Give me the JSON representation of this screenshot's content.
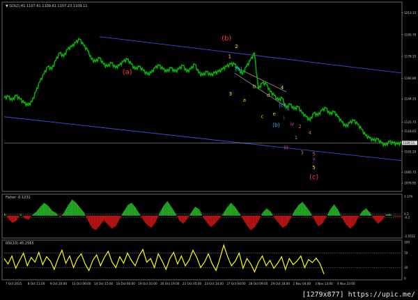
{
  "window": {
    "main_title": "▼ GOLD,H1  1107.61  1109.61  1107.23  1109.11",
    "watermark": "[1279x877] https://upic.me/"
  },
  "colors": {
    "price": "#00c000",
    "channel": "#3a4bd8",
    "hline": "#9a9a9a",
    "fisher_pos": "#23a623",
    "fisher_neg": "#b31313",
    "rsi": "#ffff00",
    "grid_dot": "#7a7a7a",
    "text": "#cfcfcf",
    "wave_red": "#ff3a2a",
    "wave_yellow": "#ffe640",
    "wave_cyan": "#29b6ff",
    "wave_magenta": "#d03dd0",
    "wave_small_yellow": "#e6d800",
    "wave_small_brown": "#c07840"
  },
  "chart_data": [
    {
      "type": "line",
      "title": "GOLD,H1",
      "ohlc": {
        "open": 1107.61,
        "high": 1109.61,
        "low": 1107.23,
        "close": 1109.11
      },
      "y_ticks": [
        1213.15,
        1195.7,
        1178.25,
        1160.8,
        1144.25,
        1125.75,
        1118.65,
        1102.2,
        1085.75,
        1076.95
      ],
      "current_price": "1109.11",
      "ylim": [
        1072,
        1220
      ],
      "x_ticks": [
        "7 Oct 2015",
        "8 Oct 11:00",
        "9 Oct 20:00",
        "13 Oct 06:00",
        "14 Oct 15:00",
        "16 Oct 00:00",
        "19 Oct 10:00",
        "20 Oct 19:00",
        "22 Oct 05:00",
        "23 Oct 14:00",
        "27 Oct 00:00",
        "28 Oct 09:00",
        "29 Oct 18:00",
        "2 Nov 04:00",
        "3 Nov 13:00",
        "4 Nov 23:00"
      ],
      "x_range": [
        0,
        100
      ],
      "series": [
        {
          "x": [
            0,
            1,
            2,
            3,
            4,
            5,
            6,
            7,
            8,
            9,
            10,
            11,
            12,
            13,
            14,
            15,
            16,
            17,
            18,
            19,
            20,
            21,
            22,
            23,
            24,
            25,
            26,
            27,
            28,
            29,
            30,
            31,
            32,
            33,
            34,
            35,
            36,
            37,
            38,
            39,
            40,
            41,
            42,
            43,
            44,
            45,
            46,
            47,
            48,
            49,
            50,
            51,
            52,
            53,
            54,
            55,
            56,
            57,
            58,
            59,
            60,
            61,
            62,
            63,
            64,
            65,
            66,
            67,
            68,
            69,
            70,
            71,
            72,
            73,
            74,
            75,
            76,
            77,
            78,
            79,
            80,
            81,
            82,
            83,
            84,
            85,
            86,
            87,
            88,
            89,
            90,
            91,
            92,
            93,
            94,
            95,
            96,
            97,
            98,
            99,
            100
          ],
          "values": [
            1145,
            1146,
            1143,
            1147,
            1144,
            1141,
            1139,
            1142,
            1150,
            1158,
            1164,
            1170,
            1168,
            1175,
            1181,
            1178,
            1184,
            1186,
            1189,
            1192,
            1187,
            1183,
            1176,
            1174,
            1177,
            1172,
            1170,
            1173,
            1169,
            1171,
            1174,
            1176,
            1172,
            1168,
            1170,
            1167,
            1164,
            1165,
            1169,
            1171,
            1168,
            1166,
            1169,
            1166,
            1168,
            1171,
            1166,
            1168,
            1172,
            1165,
            1163,
            1166,
            1163,
            1165,
            1166,
            1168,
            1170,
            1172,
            1172,
            1168,
            1164,
            1170,
            1175,
            1181,
            1152,
            1157,
            1156,
            1150,
            1147,
            1143,
            1145,
            1137,
            1140,
            1136,
            1138,
            1133,
            1130,
            1127,
            1133,
            1131,
            1135,
            1137,
            1132,
            1134,
            1130,
            1126,
            1122,
            1125,
            1127,
            1124,
            1120,
            1115,
            1113,
            1111,
            1112,
            1109,
            1107,
            1110,
            1109,
            1108,
            1109
          ]
        }
      ],
      "channel_upper": {
        "x": [
          24,
          100
        ],
        "values": [
          1194,
          1165
        ]
      },
      "channel_lower": {
        "x": [
          0,
          100
        ],
        "values": [
          1130,
          1095
        ]
      },
      "wedge_upper": {
        "x": [
          58,
          71
        ],
        "values": [
          1170,
          1150
        ]
      },
      "wedge_lower": {
        "x": [
          58,
          71
        ],
        "values": [
          1165,
          1138
        ]
      },
      "horizontal_line": 1109.11,
      "wave_labels": [
        {
          "text": "(a)",
          "x": 31,
          "y": 1164,
          "color": "wave_red"
        },
        {
          "text": "(b)",
          "x": 56,
          "y": 1191,
          "color": "wave_red"
        },
        {
          "text": "2",
          "x": 58.5,
          "y": 1185,
          "color": "wave_yellow"
        },
        {
          "text": "1",
          "x": 56.8,
          "y": 1177,
          "color": "wave_yellow"
        },
        {
          "text": "3",
          "x": 57,
          "y": 1147,
          "color": "wave_yellow"
        },
        {
          "text": "(a)",
          "x": 59,
          "y": 1167,
          "color": "wave_cyan"
        },
        {
          "text": "a",
          "x": 60.5,
          "y": 1142,
          "color": "wave_small_yellow"
        },
        {
          "text": "b",
          "x": 63,
          "y": 1153,
          "color": "wave_small_yellow"
        },
        {
          "text": "c",
          "x": 65,
          "y": 1129,
          "color": "wave_small_yellow"
        },
        {
          "text": "d",
          "x": 66.5,
          "y": 1146,
          "color": "wave_small_yellow"
        },
        {
          "text": "e",
          "x": 68,
          "y": 1131,
          "color": "wave_small_yellow"
        },
        {
          "text": "4",
          "x": 70,
          "y": 1152,
          "color": "wave_yellow"
        },
        {
          "text": "(c)",
          "x": 70,
          "y": 1138,
          "color": "wave_cyan"
        },
        {
          "text": "(b)",
          "x": 68.5,
          "y": 1122,
          "color": "wave_cyan"
        },
        {
          "text": "i",
          "x": 70.5,
          "y": 1128,
          "color": "wave_magenta"
        },
        {
          "text": "ii",
          "x": 71.5,
          "y": 1135,
          "color": "wave_magenta"
        },
        {
          "text": "iv",
          "x": 72.5,
          "y": 1123,
          "color": "wave_magenta"
        },
        {
          "text": "iii",
          "x": 71,
          "y": 1104,
          "color": "wave_magenta"
        },
        {
          "text": "1",
          "x": 73.5,
          "y": 1112,
          "color": "wave_small_brown"
        },
        {
          "text": "2",
          "x": 74.5,
          "y": 1121,
          "color": "wave_small_brown"
        },
        {
          "text": "3",
          "x": 75,
          "y": 1100,
          "color": "wave_small_brown"
        },
        {
          "text": "4",
          "x": 77,
          "y": 1116,
          "color": "wave_small_brown"
        },
        {
          "text": "5",
          "x": 78,
          "y": 1099,
          "color": "wave_small_brown"
        },
        {
          "text": "v",
          "x": 78,
          "y": 1095,
          "color": "wave_magenta"
        },
        {
          "text": "5",
          "x": 78,
          "y": 1088,
          "color": "wave_yellow"
        },
        {
          "text": "(c)",
          "x": 78,
          "y": 1080,
          "color": "wave_red"
        }
      ]
    },
    {
      "type": "bar",
      "title": "Fisher -0.1231",
      "y_ticks": [
        "2.379",
        "0.2",
        "-0.2",
        "-2.5551"
      ],
      "ylim": [
        -2.6,
        2.4
      ],
      "levels": [
        0.2,
        -0.2
      ],
      "x": [
        0,
        1,
        2,
        3,
        4,
        5,
        6,
        7,
        8,
        9,
        10,
        11,
        12,
        13,
        14,
        15,
        16,
        17,
        18,
        19,
        20,
        21,
        22,
        23,
        24,
        25,
        26,
        27,
        28,
        29,
        30,
        31,
        32,
        33,
        34,
        35,
        36,
        37,
        38,
        39,
        40,
        41,
        42,
        43,
        44,
        45,
        46,
        47,
        48,
        49,
        50,
        51,
        52,
        53,
        54,
        55,
        56,
        57,
        58,
        59,
        60,
        61,
        62,
        63,
        64,
        65,
        66,
        67,
        68,
        69,
        70,
        71,
        72,
        73,
        74,
        75,
        76,
        77,
        78,
        79,
        80,
        81,
        82,
        83,
        84,
        85,
        86,
        87,
        88,
        89,
        90,
        91,
        92,
        93,
        94,
        95,
        96,
        97,
        98,
        99,
        100
      ],
      "values": [
        0.3,
        -0.4,
        -0.9,
        -0.6,
        0.2,
        -0.3,
        -0.5,
        0.1,
        0.5,
        1.1,
        1.6,
        1.2,
        0.6,
        0.3,
        -0.2,
        0.4,
        1.3,
        2.0,
        1.6,
        1.0,
        0.4,
        -0.6,
        -1.5,
        -1.8,
        -1.2,
        -0.6,
        -1.1,
        -1.6,
        -1.3,
        -0.4,
        0.5,
        1.3,
        1.6,
        1.0,
        0.2,
        -0.6,
        -1.2,
        -1.5,
        -0.8,
        0.3,
        1.2,
        1.8,
        1.1,
        0.3,
        -0.6,
        -1.0,
        -0.4,
        0.4,
        1.1,
        0.8,
        -0.2,
        -0.9,
        -1.4,
        -1.0,
        -0.4,
        0.2,
        1.0,
        1.6,
        1.1,
        0.4,
        -0.4,
        -1.2,
        -1.8,
        -1.4,
        -0.6,
        0.4,
        0.9,
        0.5,
        -0.3,
        -0.9,
        -1.5,
        -1.2,
        -0.4,
        0.6,
        1.3,
        1.7,
        1.1,
        0.4,
        -0.5,
        -1.3,
        -1.0,
        -0.2,
        0.8,
        1.4,
        0.7,
        -0.3,
        -1.1,
        -1.6,
        -1.2,
        -0.3,
        0.5,
        0.9,
        0.4,
        -0.4,
        -1.0,
        -0.6,
        0.1,
        0.2,
        -0.1,
        -0.1,
        -0.1
      ]
    },
    {
      "type": "line",
      "title": "RSI(10) 45.2565",
      "y_ticks": [
        "100",
        "70",
        "30",
        "0"
      ],
      "ylim": [
        0,
        100
      ],
      "levels": [
        70,
        30
      ],
      "x": [
        0,
        1,
        2,
        3,
        4,
        5,
        6,
        7,
        8,
        9,
        10,
        11,
        12,
        13,
        14,
        15,
        16,
        17,
        18,
        19,
        20,
        21,
        22,
        23,
        24,
        25,
        26,
        27,
        28,
        29,
        30,
        31,
        32,
        33,
        34,
        35,
        36,
        37,
        38,
        39,
        40,
        41,
        42,
        43,
        44,
        45,
        46,
        47,
        48,
        49,
        50,
        51,
        52,
        53,
        54,
        55,
        56,
        57,
        58,
        59,
        60,
        61,
        62,
        63,
        64,
        65,
        66,
        67,
        68,
        69,
        70,
        71,
        72,
        73,
        74,
        75,
        76,
        77,
        78,
        79,
        80,
        81,
        82,
        83,
        84,
        85,
        86,
        87,
        88,
        89,
        90,
        91,
        92,
        93,
        94,
        95,
        96,
        97,
        98,
        99,
        100
      ],
      "values": [
        55,
        40,
        62,
        28,
        50,
        70,
        35,
        58,
        45,
        72,
        38,
        60,
        48,
        25,
        55,
        78,
        42,
        62,
        30,
        55,
        68,
        40,
        22,
        50,
        65,
        35,
        58,
        75,
        45,
        30,
        60,
        42,
        70,
        50,
        35,
        62,
        80,
        45,
        55,
        30,
        68,
        48,
        25,
        55,
        72,
        40,
        62,
        35,
        50,
        78,
        58,
        30,
        45,
        68,
        40,
        22,
        55,
        92,
        60,
        35,
        48,
        70,
        28,
        55,
        40,
        18,
        45,
        62,
        35,
        50,
        28,
        42,
        60,
        25,
        55,
        38,
        48,
        62,
        30,
        52,
        44,
        56,
        40,
        12,
        45,
        30,
        55,
        38,
        22,
        50,
        60,
        35,
        42,
        55,
        38,
        48,
        45,
        52,
        40,
        45,
        45
      ]
    }
  ]
}
